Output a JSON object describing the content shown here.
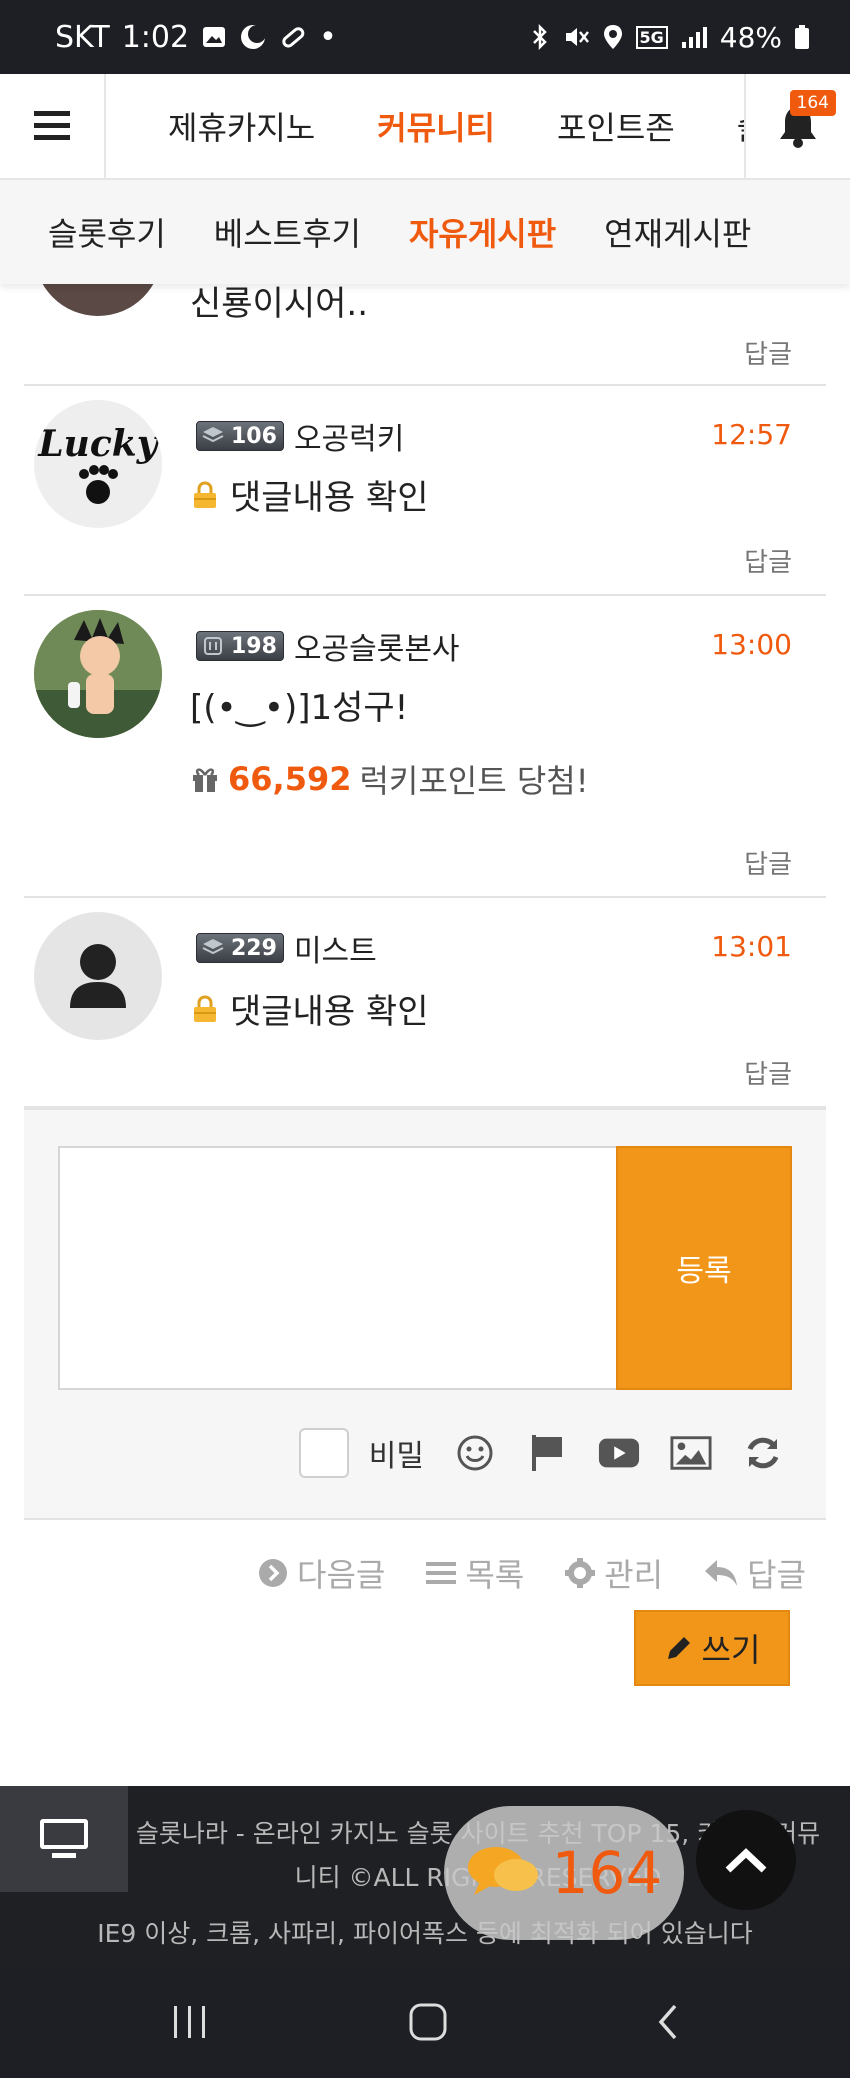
{
  "status_bar": {
    "carrier": "SKT",
    "time": "1:02",
    "dot": "•",
    "battery": "48%",
    "network": "5G"
  },
  "top_nav": {
    "items": [
      "제휴카지노",
      "커뮤니티",
      "포인트존",
      "슬"
    ],
    "active_index": 1,
    "notification_count": "164"
  },
  "sub_tabs": {
    "items": [
      "슬롯후기",
      "베스트후기",
      "자유게시판",
      "연재게시판"
    ],
    "active_index": 2
  },
  "comments": [
    {
      "body": "신룡이시어..",
      "reply": "답글"
    },
    {
      "level": "106",
      "nick": "오공럭키",
      "time": "12:57",
      "body": "댓글내용 확인",
      "locked": true,
      "reply": "답글",
      "avatar_text": "Lucky"
    },
    {
      "level": "198",
      "nick": "오공슬롯본사",
      "time": "13:00",
      "body": "[(•‿•)]1성구!",
      "points_value": "66,592",
      "points_text": "럭키포인트 당첨!",
      "reply": "답글"
    },
    {
      "level": "229",
      "nick": "미스트",
      "time": "13:01",
      "body": "댓글내용 확인",
      "locked": true,
      "reply": "답글"
    }
  ],
  "write_box": {
    "submit_label": "등록",
    "secret_label": "비밀",
    "secret_checked": false
  },
  "post_nav": {
    "next": "다음글",
    "list": "목록",
    "manage": "관리",
    "reply": "답글",
    "write": "쓰기"
  },
  "footer": {
    "line1": "슬롯나라 - 온라인 카지노 슬롯 사이트 추천 TOP 15, 카지노 커뮤니티 ©ALL RIGHTS RESERVED",
    "line2": "IE9 이상, 크롬, 사파리, 파이어폭스 등에 최적화 되어 있습니다",
    "chat_count": "164"
  },
  "colors": {
    "accent": "#f05a0e",
    "button": "#f29619",
    "dark": "#1e1f24"
  }
}
